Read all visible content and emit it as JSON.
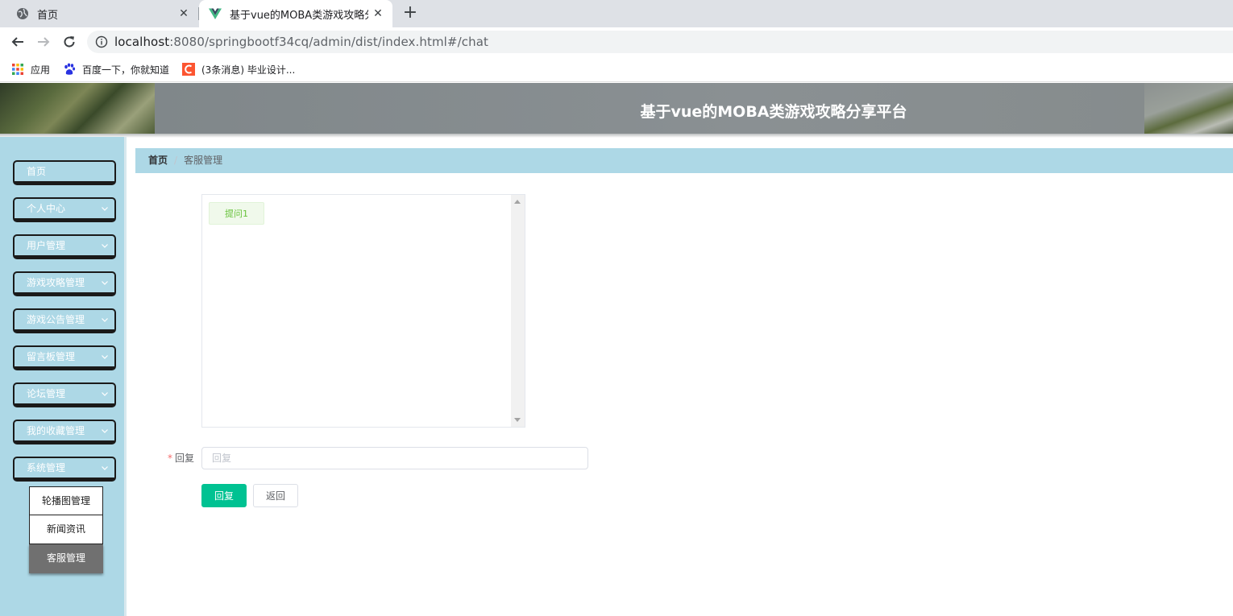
{
  "browser": {
    "tabs": [
      {
        "title": "首页"
      },
      {
        "title": "基于vue的MOBA类游戏攻略分享平台"
      }
    ],
    "url": {
      "host": "localhost",
      "rest": ":8080/springbootf34cq/admin/dist/index.html#/chat"
    },
    "bookmarks": [
      {
        "label": "应用"
      },
      {
        "label": "百度一下，你就知道"
      },
      {
        "label": "(3条消息) 毕业设计..."
      }
    ]
  },
  "header": {
    "title": "基于vue的MOBA类游戏攻略分享平台"
  },
  "sidebar": {
    "items": [
      {
        "label": "首页"
      },
      {
        "label": "个人中心"
      },
      {
        "label": "用户管理"
      },
      {
        "label": "游戏攻略管理"
      },
      {
        "label": "游戏公告管理"
      },
      {
        "label": "留言板管理"
      },
      {
        "label": "论坛管理"
      },
      {
        "label": "我的收藏管理"
      },
      {
        "label": "系统管理"
      }
    ],
    "submenu": [
      {
        "label": "轮播图管理"
      },
      {
        "label": "新闻资讯"
      },
      {
        "label": "客服管理"
      }
    ]
  },
  "breadcrumb": {
    "home": "首页",
    "separator": "/",
    "current": "客服管理"
  },
  "chat": {
    "messages": [
      {
        "text": "提问1"
      }
    ]
  },
  "form": {
    "reply_label": "回复",
    "required_mark": "*",
    "reply_placeholder": "回复",
    "reply_value": "",
    "submit_label": "回复",
    "back_label": "返回"
  },
  "colors": {
    "accent": "#00c292",
    "sidebar": "#add8e6",
    "message_bg": "#f0f9eb",
    "message_text": "#67c23a"
  }
}
